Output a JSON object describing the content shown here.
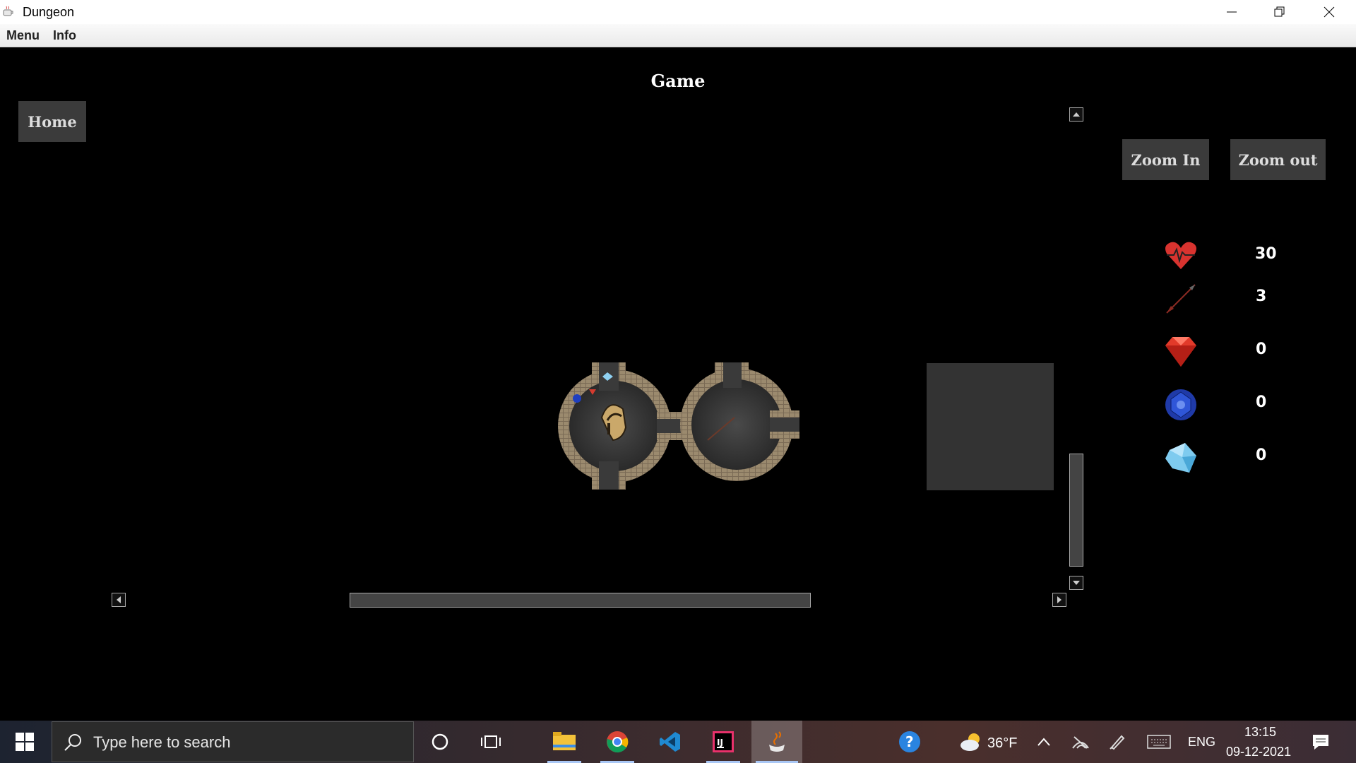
{
  "window": {
    "title": "Dungeon",
    "controls": [
      "minimize-icon",
      "restore-icon",
      "close-icon"
    ]
  },
  "menubar": {
    "items": [
      {
        "label": "Menu"
      },
      {
        "label": "Info"
      }
    ]
  },
  "game": {
    "title": "Game",
    "home_label": "Home",
    "zoom_in_label": "Zoom In",
    "zoom_out_label": "Zoom out",
    "stats": [
      {
        "icon": "heart-icon",
        "value": "30"
      },
      {
        "icon": "arrow-icon",
        "value": "3"
      },
      {
        "icon": "ruby-icon",
        "value": "0"
      },
      {
        "icon": "sapphire-icon",
        "value": "0"
      },
      {
        "icon": "diamond-icon",
        "value": "0"
      }
    ]
  },
  "taskbar": {
    "search_placeholder": "Type here to search",
    "weather": "36°F",
    "language": "ENG",
    "time": "13:15",
    "date": "09-12-2021",
    "pinned": [
      "file-explorer-icon",
      "chrome-icon",
      "vscode-icon",
      "intellij-icon",
      "java-icon"
    ]
  },
  "colors": {
    "button_bg": "#3b3b3b",
    "game_bg": "#000000",
    "taskbar_accent": "#a9c7f5"
  }
}
